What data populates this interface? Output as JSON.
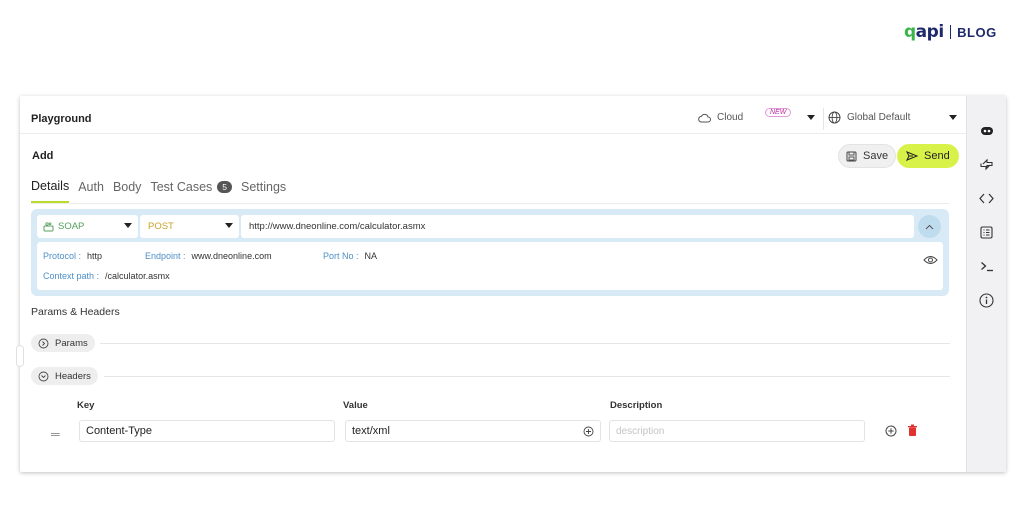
{
  "logo": {
    "mark_q": "q",
    "mark_rest": "api",
    "label": "BLOG"
  },
  "header": {
    "title": "Playground",
    "cloud_label": "Cloud",
    "new_badge": "NEW",
    "environment": "Global Default"
  },
  "request": {
    "title": "Add",
    "save_label": "Save",
    "send_label": "Send"
  },
  "tabs": [
    {
      "label": "Details",
      "active": true
    },
    {
      "label": "Auth"
    },
    {
      "label": "Body"
    },
    {
      "label": "Test Cases",
      "count": "5"
    },
    {
      "label": "Settings"
    }
  ],
  "url_bar": {
    "protocol": "SOAP",
    "method": "POST",
    "url": "http://www.dneonline.com/calculator.asmx"
  },
  "details": {
    "protocol_label": "Protocol :",
    "protocol_value": "http",
    "endpoint_label": "Endpoint :",
    "endpoint_value": "www.dneonline.com",
    "port_label": "Port No :",
    "port_value": "NA",
    "context_label": "Context path :",
    "context_value": "/calculator.asmx"
  },
  "params_headers": {
    "title": "Params & Headers",
    "params_label": "Params",
    "headers_label": "Headers",
    "columns": {
      "key": "Key",
      "value": "Value",
      "description": "Description"
    },
    "rows": [
      {
        "key": "Content-Type",
        "value": "text/xml",
        "description_placeholder": "description"
      }
    ]
  },
  "colors": {
    "accent": "#d9f24a",
    "tab_underline": "#b9dd2b",
    "url_panel": "#d8eaf6",
    "protocol_text": "#57a05c",
    "method_text": "#c6a22a",
    "detail_key": "#4d8fc7",
    "delete_icon": "#e0332f"
  },
  "sidebar_icons": [
    "bot-icon",
    "share-icon",
    "code-icon",
    "list-icon",
    "terminal-icon",
    "info-icon"
  ]
}
